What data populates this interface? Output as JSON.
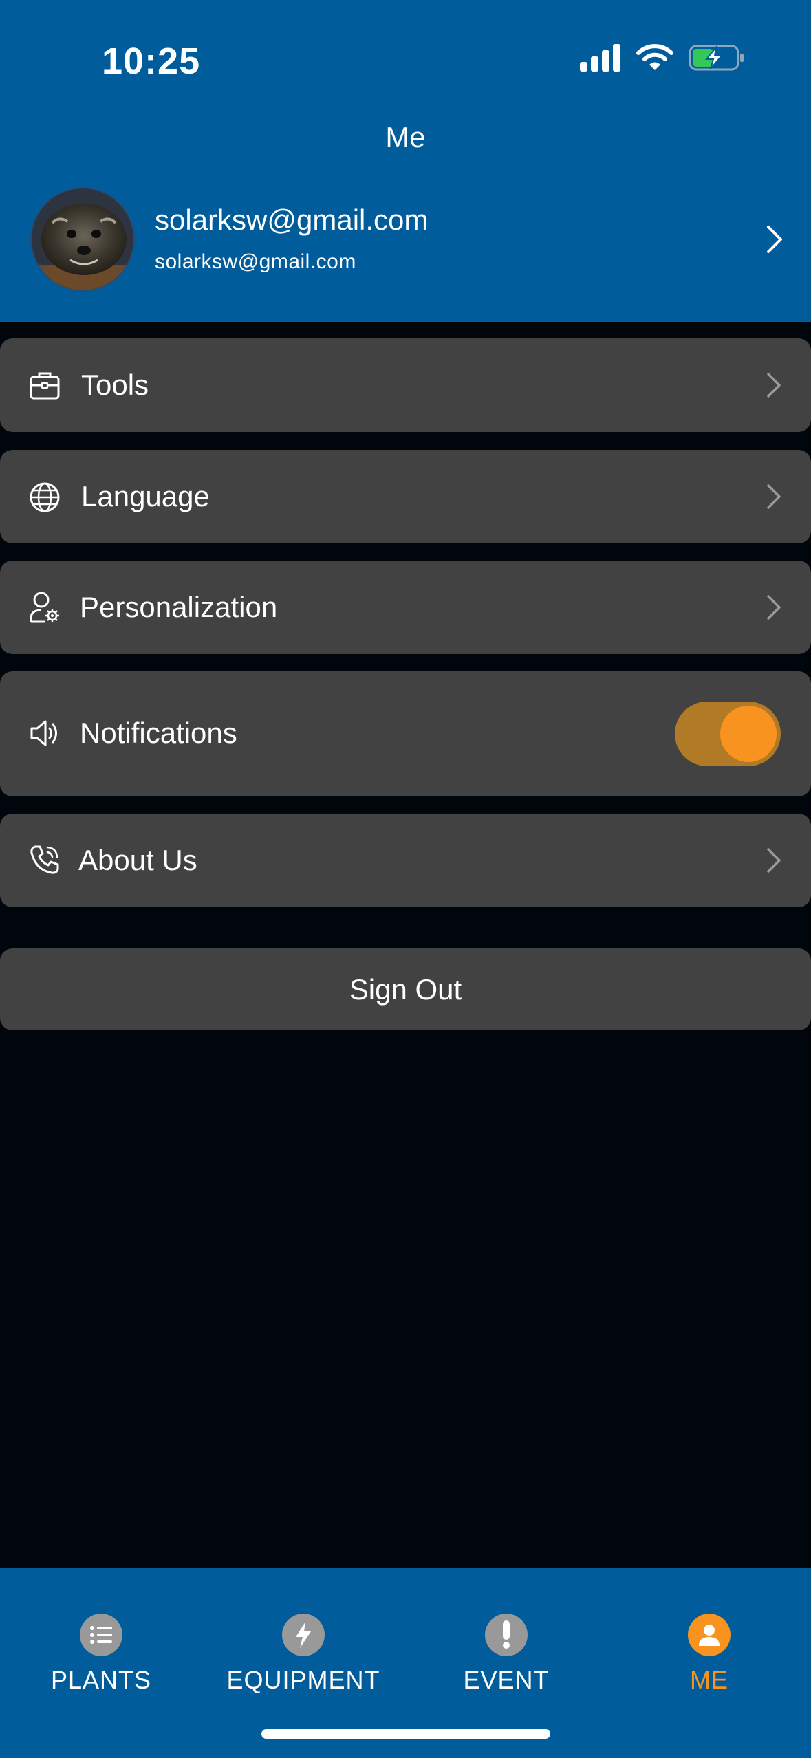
{
  "status_bar": {
    "time": "10:25"
  },
  "header": {
    "title": "Me"
  },
  "profile": {
    "name": "solarksw@gmail.com",
    "email": "solarksw@gmail.com"
  },
  "menu": {
    "tools": "Tools",
    "language": "Language",
    "personalization": "Personalization",
    "notifications": "Notifications",
    "notifications_enabled": true,
    "about": "About Us"
  },
  "sign_out": "Sign Out",
  "tabs": [
    {
      "label": "PLANTS",
      "icon": "list-icon",
      "active": false
    },
    {
      "label": "EQUIPMENT",
      "icon": "bolt-icon",
      "active": false
    },
    {
      "label": "EVENT",
      "icon": "exclamation-icon",
      "active": false
    },
    {
      "label": "ME",
      "icon": "person-icon",
      "active": true
    }
  ],
  "colors": {
    "header_bg": "#015c9c",
    "page_bg": "#01060d",
    "card_bg": "#424242",
    "accent": "#f7931e",
    "toggle_track": "#b17a26",
    "tab_inactive_icon": "#999999"
  }
}
